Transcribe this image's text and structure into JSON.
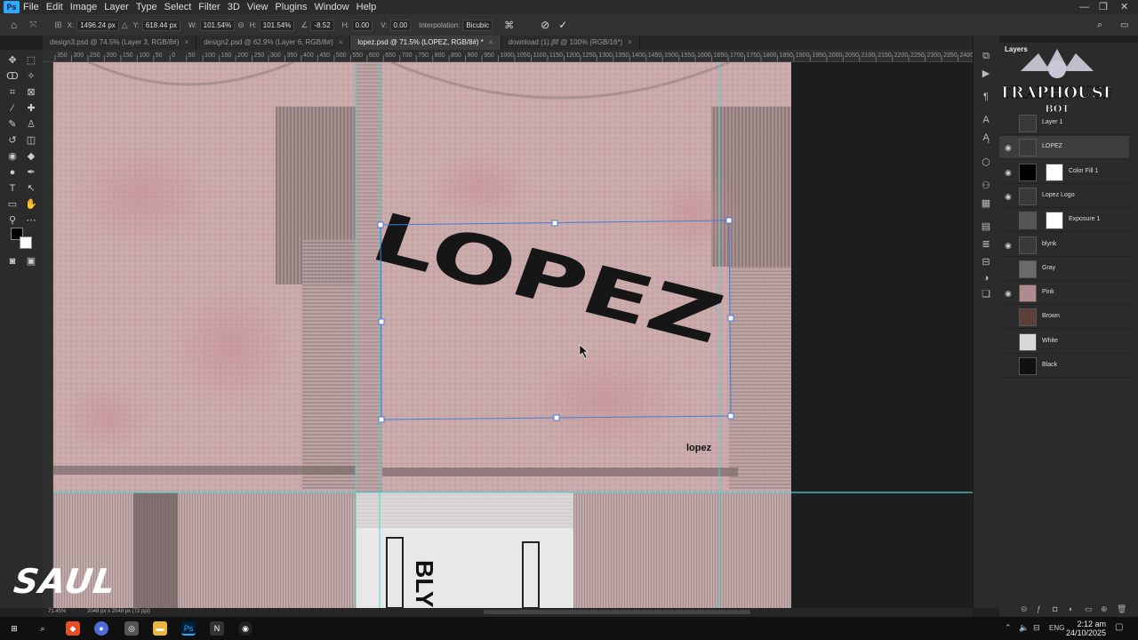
{
  "menu": [
    "File",
    "Edit",
    "Image",
    "Layer",
    "Type",
    "Select",
    "Filter",
    "3D",
    "View",
    "Plugins",
    "Window",
    "Help"
  ],
  "options": {
    "x_value": "1496.24 px",
    "y_value": "618.44 px",
    "w_value": "101.54%",
    "h_value": "101.54%",
    "angle_value": "-8.52",
    "h_skew_value": "0.00",
    "v_skew_value": "0.00",
    "interpolation_label": "Interpolation:",
    "interpolation_value": "Bicubic",
    "x_label": "X:",
    "y_label": "Y:",
    "w_label": "W:",
    "h_label": "H:",
    "hs_label": "H:",
    "vs_label": "V:"
  },
  "tabs": [
    "design3.psd @ 74.5% (Layer 3, RGB/8#)",
    "design2.psd @ 62.9% (Layer 6, RGB/8#)",
    "lopez.psd @ 71.5% (LOPEZ, RGB/8#) *",
    "download (1).jfif @ 100% (RGB/16*)"
  ],
  "active_tab_index": 2,
  "ruler_ticks": [
    "350",
    "300",
    "250",
    "200",
    "150",
    "100",
    "50",
    "0",
    "50",
    "100",
    "150",
    "200",
    "250",
    "300",
    "350",
    "400",
    "450",
    "500",
    "550",
    "600",
    "650",
    "700",
    "750",
    "800",
    "850",
    "900",
    "950",
    "1000",
    "1050",
    "1100",
    "1150",
    "1200",
    "1250",
    "1300",
    "1350",
    "1400",
    "1450",
    "1500",
    "1550",
    "1600",
    "1650",
    "1700",
    "1750",
    "1800",
    "1850",
    "1900",
    "1950",
    "2000",
    "2050",
    "2100",
    "2150",
    "2200",
    "2250",
    "2300",
    "2350",
    "2400"
  ],
  "canvas": {
    "big_text": "LOPEZ",
    "small_logo": "lopez",
    "overlay_text": "SAUL",
    "bottom_print": "BLYNK"
  },
  "layers_panel": {
    "title": "Layers",
    "watermark_text": "TRAPHOUSE",
    "watermark_sub": "BOT",
    "layers": [
      {
        "name": "Layer 1",
        "visible": false,
        "thumb": "#3a3a3a",
        "selected": false,
        "mask": false
      },
      {
        "name": "LOPEZ",
        "visible": true,
        "thumb": "#3a3a3a",
        "selected": true,
        "mask": false
      },
      {
        "name": "Color Fill 1",
        "visible": true,
        "thumb": "#000000",
        "selected": false,
        "mask": true
      },
      {
        "name": "Lopez Logo",
        "visible": true,
        "thumb": "#3a3a3a",
        "selected": false,
        "mask": false
      },
      {
        "name": "Exposure 1",
        "visible": false,
        "thumb": "#555555",
        "selected": false,
        "mask": true
      },
      {
        "name": "blynk",
        "visible": true,
        "thumb": "#3a3a3a",
        "selected": false,
        "mask": false
      },
      {
        "name": "Gray",
        "visible": false,
        "thumb": "#6a6a6a",
        "selected": false,
        "mask": false
      },
      {
        "name": "Pink",
        "visible": true,
        "thumb": "#b08a8c",
        "selected": false,
        "mask": false
      },
      {
        "name": "Brown",
        "visible": false,
        "thumb": "#5a4038",
        "selected": false,
        "mask": false
      },
      {
        "name": "White",
        "visible": false,
        "thumb": "#d8d8d8",
        "selected": false,
        "mask": false
      },
      {
        "name": "Black",
        "visible": false,
        "thumb": "#111111",
        "selected": false,
        "mask": false
      }
    ]
  },
  "status": {
    "zoom": "71.45%",
    "doc_size": "2048 px x 2048 px (72 ppi)"
  },
  "taskbar": {
    "time": "2:12 am",
    "date": "24/10/2025",
    "lang": "ENG"
  },
  "colors": {
    "shirt_pink": "#c9a9aa",
    "guide_cyan": "#4fd1d9",
    "selection_blue": "#4a7bd8",
    "ps_blue": "#31a8ff"
  }
}
